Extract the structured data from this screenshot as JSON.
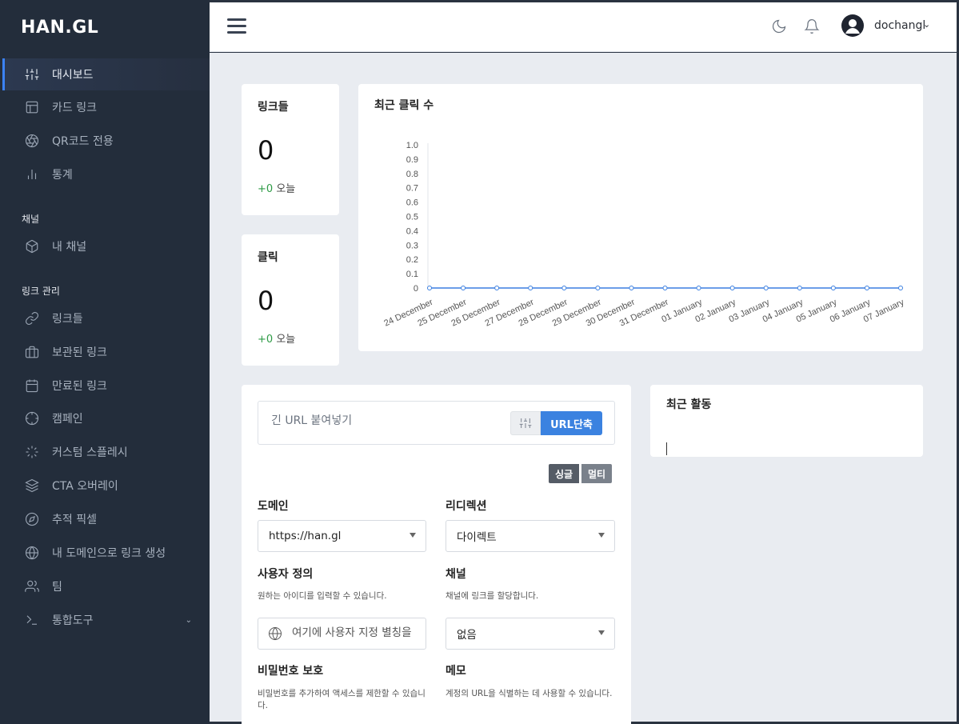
{
  "app": {
    "logo": "HAN.GL"
  },
  "sidebar": {
    "items": [
      {
        "label": "대시보드",
        "icon": "sliders-icon"
      },
      {
        "label": "카드 링크",
        "icon": "layout-icon"
      },
      {
        "label": "QR코드 전용",
        "icon": "aperture-icon"
      },
      {
        "label": "통계",
        "icon": "bar-chart-icon"
      }
    ],
    "channel_section": "채널",
    "channel_items": [
      {
        "label": "내 채널",
        "icon": "box-icon"
      }
    ],
    "link_section": "링크 관리",
    "link_items": [
      {
        "label": "링크들",
        "icon": "link-icon"
      },
      {
        "label": "보관된 링크",
        "icon": "briefcase-icon"
      },
      {
        "label": "만료된 링크",
        "icon": "calendar-icon"
      },
      {
        "label": "캠페인",
        "icon": "crosshair-icon"
      },
      {
        "label": "커스텀 스플레시",
        "icon": "loader-icon"
      },
      {
        "label": "CTA 오버레이",
        "icon": "layers-icon"
      },
      {
        "label": "추적 픽셀",
        "icon": "compass-icon"
      },
      {
        "label": "내 도메인으로 링크 생성",
        "icon": "globe-icon"
      },
      {
        "label": "팀",
        "icon": "users-icon"
      },
      {
        "label": "통합도구",
        "icon": "terminal-icon"
      }
    ]
  },
  "topbar": {
    "username": "dochangl",
    "caret": "⌄"
  },
  "stats": {
    "links": {
      "title": "링크들",
      "value": "0",
      "delta": "+0",
      "today": "오늘"
    },
    "clicks": {
      "title": "클릭",
      "value": "0",
      "delta": "+0",
      "today": "오늘"
    }
  },
  "chart_card": {
    "title": "최근 클릭 수"
  },
  "chart_data": {
    "type": "line",
    "title": "",
    "xlabel": "",
    "ylabel": "",
    "ylim": [
      0,
      1.0
    ],
    "yticks": [
      "1.0",
      "0.9",
      "0.8",
      "0.7",
      "0.6",
      "0.5",
      "0.4",
      "0.3",
      "0.2",
      "0.1",
      "0"
    ],
    "categories": [
      "24 December",
      "25 December",
      "26 December",
      "27 December",
      "28 December",
      "29 December",
      "30 December",
      "31 December",
      "01 January",
      "02 January",
      "03 January",
      "04 January",
      "05 January",
      "06 January",
      "07 January"
    ],
    "series": [
      {
        "values": [
          0,
          0,
          0,
          0,
          0,
          0,
          0,
          0,
          0,
          0,
          0,
          0,
          0,
          0,
          0
        ]
      }
    ],
    "colors": {
      "line": "#3b7fe0"
    },
    "grid": false
  },
  "shortener": {
    "placeholder": "긴 URL 붙여넣기",
    "button": "URL단축",
    "toggle_single": "싱글",
    "toggle_multi": "멀티",
    "domain_label": "도메인",
    "domain_value": "https://han.gl",
    "redirect_label": "리디렉션",
    "redirect_value": "다이렉트",
    "alias_label": "사용자 정의",
    "alias_help": "원하는 아이디를 입력할 수 있습니다.",
    "alias_placeholder": "여기에 사용자 지정 별칭을",
    "channel_label": "채널",
    "channel_help": "채널에 링크를 할당합니다.",
    "channel_value": "없음",
    "password_label": "비밀번호 보호",
    "password_help": "비밀번호를 추가하여 액세스를 제한할 수 있습니다.",
    "memo_label": "메모",
    "memo_help": "계정의 URL을 식별하는 데 사용할 수 있습니다."
  },
  "activity": {
    "title": "최근 활동"
  },
  "colors": {
    "accent": "#3b82e0",
    "positive": "#2e9b46",
    "sidebar": "#232d3b"
  }
}
